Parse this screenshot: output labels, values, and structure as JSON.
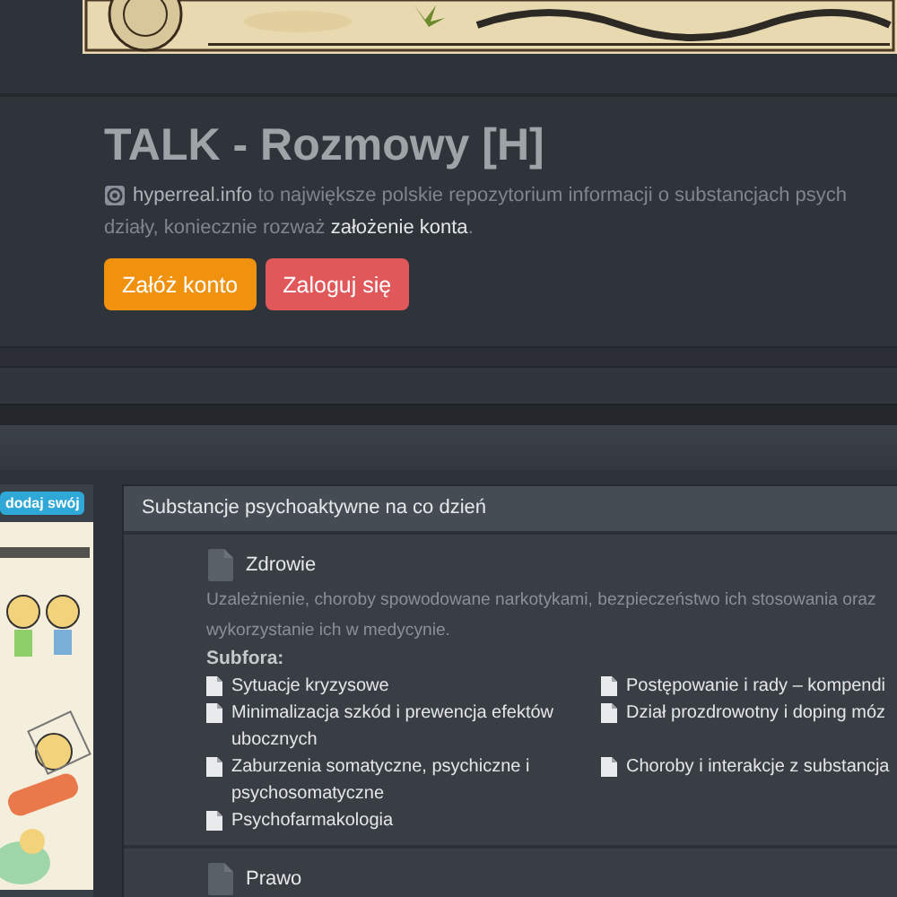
{
  "header": {
    "title": "TALK - Rozmowy [H]",
    "intro": "**hyperreal.info** to największe polskie repozytorium informacji o substancjach psych",
    "intro_cont": "działy, koniecznie rozważ ",
    "intro_link": "założenie konta",
    "intro_end": ".",
    "buttons": [
      {
        "label": "Załóż konto",
        "kind": "primary"
      },
      {
        "label": "Zaloguj się",
        "kind": "danger"
      }
    ]
  },
  "sidebar": {
    "badge": "dodaj swój"
  },
  "category": {
    "title": "Substancje psychoaktywne na co dzień",
    "forums": [
      {
        "title": "Zdrowie",
        "description": "Uzależnienie, choroby spowodowane narkotykami, bezpieczeństwo ich stosowania oraz",
        "description_cont": "wykorzystanie ich w medycynie.",
        "subforums_label": "Subfora:",
        "subforums": [
          "Sytuacje kryzysowe",
          "Postępowanie i rady – kompendi",
          "Minimalizacja szkód i prewencja efektów ubocznych",
          "Dział prozdrowotny i doping móz",
          "Zaburzenia somatyczne, psychiczne i psychosomatyczne",
          "Choroby i interakcje z substancja",
          "Psychofarmakologia"
        ]
      },
      {
        "title": "Prawo"
      }
    ]
  }
}
